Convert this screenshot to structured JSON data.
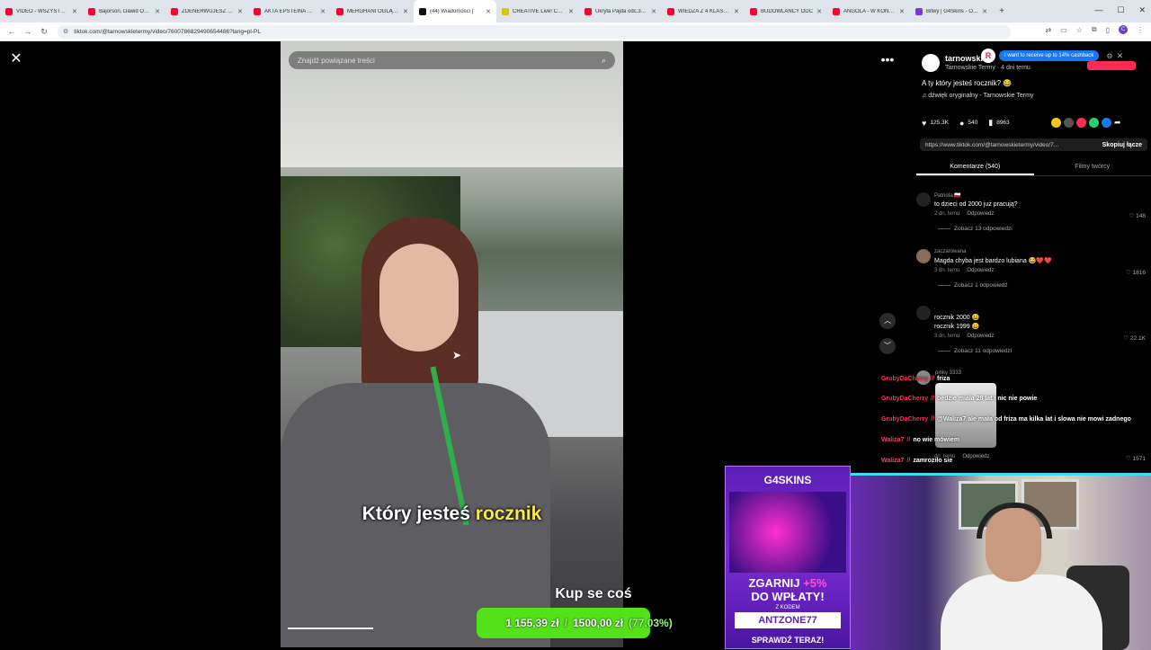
{
  "browser": {
    "tabs": [
      {
        "label": "VIDEO - WSZYSTKO JE",
        "color": "#ff0033"
      },
      {
        "label": "Bajorson, Dawid Obser",
        "color": "#ff0033"
      },
      {
        "label": "ZDENERWUJESZ ROBI",
        "color": "#ff0033"
      },
      {
        "label": "AKTA EPSTEINA WSTR",
        "color": "#ff0033"
      },
      {
        "label": "MERGHANI OGLĄDA",
        "color": "#ff0033"
      },
      {
        "label": "(44) Wiadomości |",
        "color": "#111111",
        "active": true
      },
      {
        "label": "CREATIVE Live! Cam Sy",
        "color": "#d8c700"
      },
      {
        "label": "Ukryta Pajda odc.3 - Yo",
        "color": "#ff0033"
      },
      {
        "label": "WIEDZA Z 4 KLASY VS",
        "color": "#ff0033"
      },
      {
        "label": "BUDOWLANCY ODC",
        "color": "#ff0033"
      },
      {
        "label": "ANGOLA - W KOŃCU",
        "color": "#ff0033"
      },
      {
        "label": "Bitwy | G4Skins - Ohm",
        "color": "#7b35e0"
      }
    ],
    "new_tab": "+",
    "url": "tiktok.com/@tarnowskietermy/video/7600786829490654486?lang=pl-PL",
    "profile_initial": "C"
  },
  "player": {
    "search_placeholder": "Znajdź powiązane treści",
    "caption_white": "Który jesteś",
    "caption_highlight": "rocznik",
    "progress_fraction": 0.25
  },
  "goal": {
    "title": "Kup se coś",
    "current": "1 155,39 zł",
    "separator": "/",
    "target": "1500,00 zł",
    "percent": "(77.03%)",
    "fraction": 0.7703
  },
  "sidebar": {
    "author_name": "tarnowski",
    "author_sub": "Tarnowskie Termy · 4 dni temu",
    "cashback_logo": "R",
    "cashback_text": "I want to receive up to 14% cashback",
    "description": "A ty który jesteś rocznik? 😂",
    "music": "♫  dźwięk oryginalny - Tarnowskie Termy",
    "likes": "125.3K",
    "comments_count": "540",
    "saves": "8963",
    "link": "https://www.tiktok.com/@tarnowskietermy/video/7...",
    "copy_link": "Skopiuj łącze",
    "tab_comments": "Komentarze (540)",
    "tab_creator": "Filmy twórcy"
  },
  "comments": [
    {
      "user": "Patriota 🇵🇱",
      "text": "to dzieci od 2000 już pracują?",
      "time": "2 dn. temu",
      "reply": "Odpowiedz",
      "likes": "148",
      "replies": "Zobacz 13 odpowiedzi"
    },
    {
      "user": "zaczarowana",
      "text": "Magda chyba jest bardzo lubiana 😂❤️❤️",
      "time": "3 dn. temu",
      "reply": "Odpowiedz",
      "likes": "1816",
      "replies": "Zobacz 1 odpowiedź"
    },
    {
      "user": ".",
      "text": "rocznik 2000 😀",
      "text2": "rocznik 1999 😀",
      "time": "3 dn. temu",
      "reply": "Odpowiedz",
      "likes": "22.1K",
      "replies": "Zobacz 11 odpowiedzi"
    },
    {
      "user": "pinky 3333",
      "time": "dn. temu",
      "reply": "Odpowiedz",
      "likes": "1571"
    }
  ],
  "chat": [
    {
      "user": "GrubyDaCherry",
      "badge": "//",
      "msg": "friza"
    },
    {
      "user": "GrubyDaCherry",
      "badge": "//",
      "msg": "bedzie miala 28 lat i nic nie powie"
    },
    {
      "user": "GrubyDaCherry",
      "badge": "//",
      "msg": "@Waliza7 ale mała od friza ma kilka lat i slowa nie mowi zadnego"
    },
    {
      "user": "Waliza7",
      "badge": "//",
      "msg": "no wie mówiem"
    },
    {
      "user": "Waliza7",
      "badge": "//",
      "msg": "zamroziło sie"
    }
  ],
  "ad": {
    "brand": "G4SKINS",
    "line1_a": "ZGARNIJ ",
    "line1_pct": "+5%",
    "line2": "DO WPŁATY!",
    "code_label": "Z KODEM",
    "code": "ANTZONE77",
    "cta": "SPRAWDŹ TERAZ!"
  },
  "icons": {
    "close": "✕",
    "more": "•••",
    "up": "︿",
    "down": "﹀",
    "search": "⌕"
  }
}
